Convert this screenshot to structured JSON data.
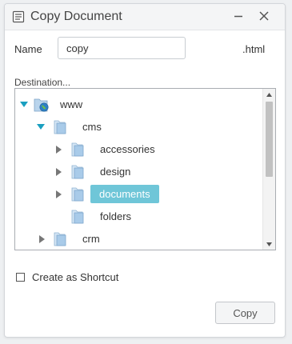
{
  "window": {
    "title": "Copy Document"
  },
  "form": {
    "name_label": "Name",
    "name_value": "copy",
    "extension": ".html",
    "destination_label": "Destination..."
  },
  "tree": {
    "nodes": [
      {
        "label": "www",
        "depth": 0,
        "expanded": true,
        "icon": "globe-folder-icon"
      },
      {
        "label": "cms",
        "depth": 1,
        "expanded": true,
        "icon": "folder-icon"
      },
      {
        "label": "accessories",
        "depth": 2,
        "expanded": false,
        "icon": "folder-icon"
      },
      {
        "label": "design",
        "depth": 2,
        "expanded": false,
        "icon": "folder-icon"
      },
      {
        "label": "documents",
        "depth": 2,
        "expanded": false,
        "selected": true,
        "icon": "folder-icon"
      },
      {
        "label": "folders",
        "depth": 2,
        "leaf": true,
        "icon": "folder-icon"
      },
      {
        "label": "crm",
        "depth": 1,
        "expanded": false,
        "icon": "folder-icon"
      }
    ]
  },
  "options": {
    "shortcut_label": "Create as Shortcut",
    "shortcut_checked": false
  },
  "actions": {
    "copy_label": "Copy"
  },
  "colors": {
    "selection": "#6fc6d8",
    "expand_arrow": "#1a9fc0"
  }
}
